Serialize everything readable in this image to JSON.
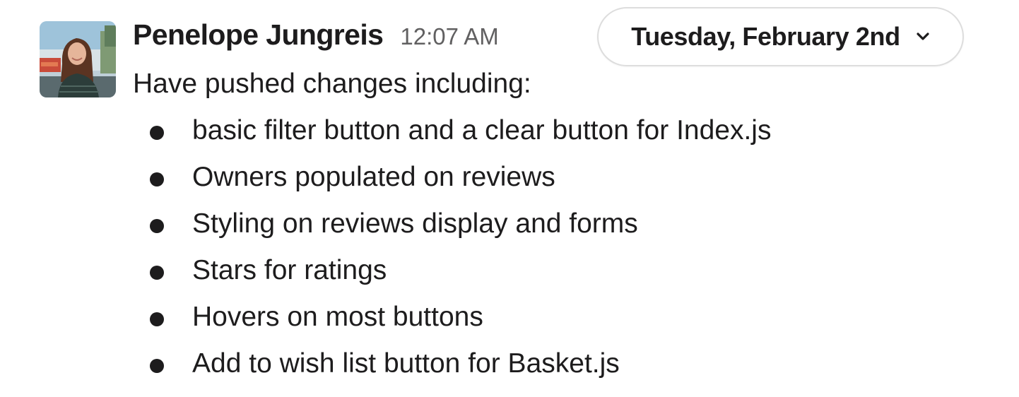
{
  "message": {
    "author": "Penelope Jungreis",
    "timestamp": "12:07 AM",
    "intro": "Have pushed changes including:",
    "items": [
      "basic filter button and a clear button for Index.js",
      "Owners populated on reviews",
      "Styling on reviews display and forms",
      "Stars for ratings",
      "Hovers on most buttons",
      "Add to wish list button for Basket.js"
    ]
  },
  "date_divider": {
    "label": "Tuesday, February 2nd",
    "icon": "chevron-down-icon"
  },
  "colors": {
    "text": "#1d1c1d",
    "muted": "#616061",
    "pill_border": "#dddddd"
  }
}
